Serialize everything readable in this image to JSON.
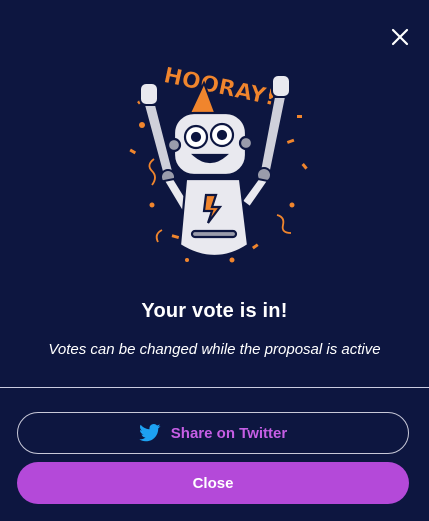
{
  "dialog": {
    "title": "Your vote is in!",
    "subtitle": "Votes can be changed while the proposal is active",
    "illustration_text": "HOORAY!",
    "close_icon": "close-icon",
    "illustration": "celebrating-robot-illustration"
  },
  "actions": {
    "share_label": "Share on Twitter",
    "share_icon": "twitter-icon",
    "close_label": "Close"
  },
  "colors": {
    "background": "#0d1640",
    "accent": "#b449d9",
    "share_text": "#c55ee4",
    "twitter_blue": "#1da1f2",
    "confetti": "#f0852d"
  }
}
